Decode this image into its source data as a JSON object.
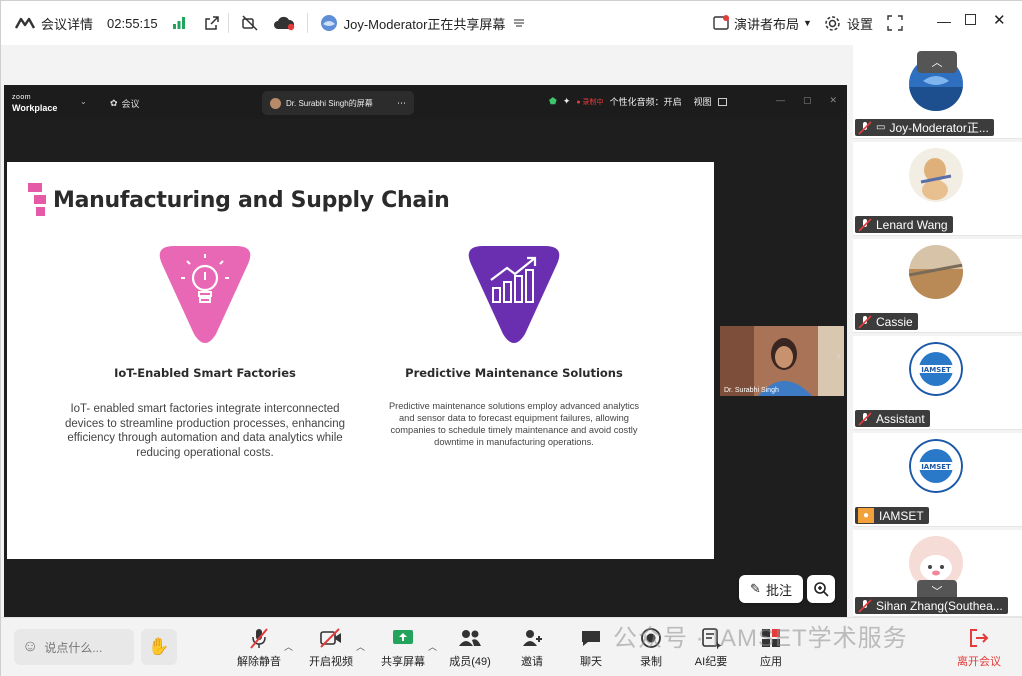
{
  "topbar": {
    "meeting_info": "会议详情",
    "timer": "02:55:15",
    "sharing_text": "Joy-Moderator正在共享屏幕",
    "layout_label": "演讲者布局",
    "settings_label": "设置"
  },
  "share_window": {
    "brand_small": "zoom",
    "brand": "Workplace",
    "meeting_tab": "会议",
    "share_tab": "Dr. Surabhi Singh的屏幕",
    "audio_label": "个性化音频：开启",
    "view_label": "视图"
  },
  "slide": {
    "title": "Manufacturing and Supply Chain",
    "left_heading": "IoT-Enabled Smart Factories",
    "left_body": "IoT- enabled smart factories integrate interconnected devices to streamline production processes, enhancing efficiency through automation and data analytics while reducing operational costs.",
    "right_heading": "Predictive Maintenance Solutions",
    "right_body": "Predictive maintenance solutions employ advanced analytics and sensor data to forecast equipment failures, allowing companies to schedule timely maintenance and avoid costly downtime in manufacturing operations.",
    "colors": {
      "pink": "#e868b6",
      "purple": "#6a2fb0"
    }
  },
  "thumbnail": {
    "name": "Dr. Surabhi Singh"
  },
  "annotate_label": "批注",
  "participants": [
    {
      "name": "Joy-Moderator正...",
      "icon": "screen-share-icon"
    },
    {
      "name": "Lenard Wang",
      "icon": ""
    },
    {
      "name": "Cassie",
      "icon": ""
    },
    {
      "name": "Assistant",
      "icon": ""
    },
    {
      "name": "IAMSET",
      "icon": "user-icon"
    },
    {
      "name": "Sihan Zhang(Southea...",
      "icon": ""
    }
  ],
  "iamset_logo_text": "IAMSET",
  "toolbar": {
    "chat_placeholder": "说点什么...",
    "items": [
      {
        "label": "解除静音"
      },
      {
        "label": "开启视频"
      },
      {
        "label": "共享屏幕"
      },
      {
        "label": "成员(49)"
      },
      {
        "label": "邀请"
      },
      {
        "label": "聊天"
      },
      {
        "label": "录制"
      },
      {
        "label": "AI纪要"
      },
      {
        "label": "应用"
      },
      {
        "label": "离开会议"
      }
    ]
  },
  "watermark": "公众号 · IAMSET学术服务"
}
